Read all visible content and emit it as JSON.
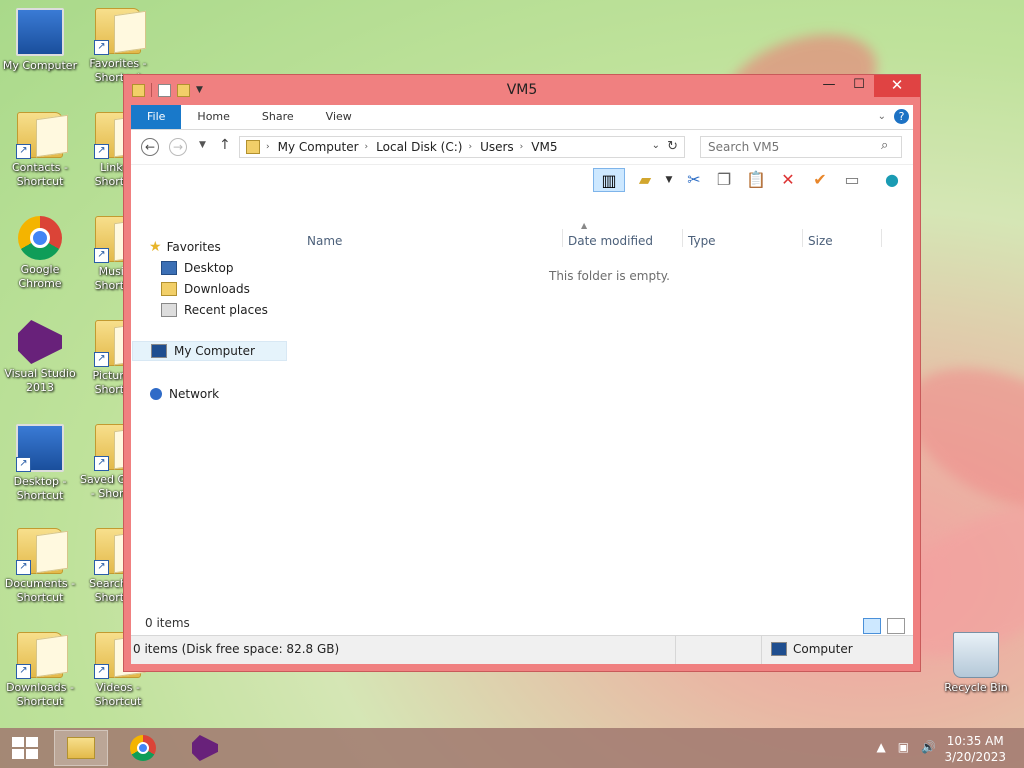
{
  "desktop": {
    "icons": [
      {
        "label": "My Computer"
      },
      {
        "label": "Favorites - Shortcut"
      },
      {
        "label": "Contacts - Shortcut"
      },
      {
        "label": "Links - Shortcut"
      },
      {
        "label": "Google Chrome"
      },
      {
        "label": "Music - Shortcut"
      },
      {
        "label": "Visual Studio 2013"
      },
      {
        "label": "Pictures - Shortcut"
      },
      {
        "label": "Desktop - Shortcut"
      },
      {
        "label": "Saved Games - Shortcut"
      },
      {
        "label": "Documents - Shortcut"
      },
      {
        "label": "Searches - Shortcut"
      },
      {
        "label": "Downloads - Shortcut"
      },
      {
        "label": "Videos - Shortcut"
      },
      {
        "label": "Recycle Bin"
      }
    ]
  },
  "window": {
    "title": "VM5",
    "controls": {
      "minimize": "—",
      "maximize": "☐",
      "close": "✕"
    },
    "ribbon_tabs": [
      "File",
      "Home",
      "Share",
      "View"
    ],
    "address": {
      "crumbs": [
        "My Computer",
        "Local Disk (C:)",
        "Users",
        "VM5"
      ]
    },
    "search": {
      "placeholder": "Search VM5"
    },
    "nav_pane": {
      "favorites": "Favorites",
      "favorites_items": [
        "Desktop",
        "Downloads",
        "Recent places"
      ],
      "computer": "My Computer",
      "network": "Network"
    },
    "columns": [
      "Name",
      "Date modified",
      "Type",
      "Size"
    ],
    "empty_message": "This folder is empty.",
    "item_count": "0 items",
    "status": {
      "left": "0 items (Disk free space: 82.8 GB)",
      "right": "Computer"
    }
  },
  "taskbar": {
    "time": "10:35 AM",
    "date": "3/20/2023"
  },
  "colors": {
    "window_frame": "#f08080",
    "close_button": "#e04343",
    "file_tab": "#1979ca",
    "accent_blue": "#1d72c4"
  }
}
